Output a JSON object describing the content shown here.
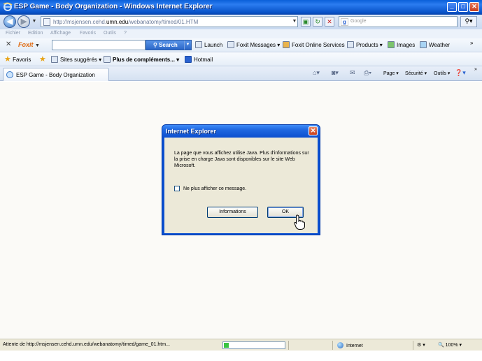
{
  "window": {
    "title": "ESP Game - Body Organization - Windows Internet Explorer",
    "buttons": {
      "minimize": "_",
      "maximize": "□",
      "close": "✕"
    }
  },
  "address": {
    "url_prefix": "http://msjensen.cehd.",
    "url_domain": "umn.edu",
    "url_suffix": "/webanatomy/timed/01.HTM",
    "search_placeholder": "Google"
  },
  "menu": [
    "Fichier",
    "Edition",
    "Affichage",
    "Favoris",
    "Outils",
    "?"
  ],
  "foxit_toolbar": {
    "close": "✕",
    "logo": "Foxit",
    "search_label": "Search",
    "items": [
      "Launch",
      "Foxit Messages",
      "Foxit Online Services",
      "Products",
      "Images",
      "Weather"
    ]
  },
  "favorites_bar": {
    "favorites": "Favoris",
    "items": [
      "Sites suggérés",
      "Plus de compléments...",
      "Hotmail"
    ]
  },
  "tabs": {
    "active_tab": "ESP Game - Body Organization",
    "commands": [
      "Page",
      "Sécurité",
      "Outils"
    ]
  },
  "dialog": {
    "title": "Internet Explorer",
    "message": "La page que vous affichez utilise Java. Plus d'informations sur la prise en charge Java sont disponibles sur le site Web Microsoft.",
    "checkbox_label": "Ne plus afficher ce message.",
    "checkbox_checked": false,
    "info_button": "Informations",
    "ok_button": "OK"
  },
  "status": {
    "text": "Attente de http://msjensen.cehd.umn.edu/webanatomy/timed/game_01.htm...",
    "progress_fraction": 0.08,
    "zone": "Internet",
    "zoom": "100%"
  },
  "colors": {
    "titlebar": "#0a5fd8",
    "dialog_frame": "#0a4fd0",
    "dialog_body": "#ece9d8",
    "progress_fill": "#3bc443"
  }
}
